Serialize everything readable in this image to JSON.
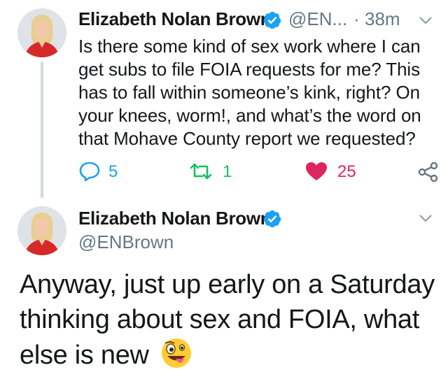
{
  "tweet1": {
    "author_name": "Elizabeth Nolan Brown",
    "handle": "@EN...",
    "separator": "·",
    "time": "38m",
    "text": "Is there some kind of sex work where I can get subs to file FOIA requests for me? This has to fall within someone’s kink, right? On your knees, worm!, and what’s the word on that Mohave County report we requested?",
    "replies": "5",
    "retweets": "1",
    "likes": "25"
  },
  "tweet2": {
    "author_name": "Elizabeth Nolan Brown",
    "handle": "@ENBrown",
    "text": "Anyway, just up early on a Saturday thinking about sex and FOIA, what else is new",
    "emoji": "🤪"
  },
  "colors": {
    "verified": "#1da1f2",
    "retweet": "#17bf63",
    "like": "#e0245e",
    "reply": "#1da1f2",
    "muted": "#657786"
  },
  "icons": [
    "verified-badge-icon",
    "chevron-down-icon",
    "reply-icon",
    "retweet-icon",
    "heart-icon",
    "share-icon",
    "emoji-zany-face"
  ]
}
